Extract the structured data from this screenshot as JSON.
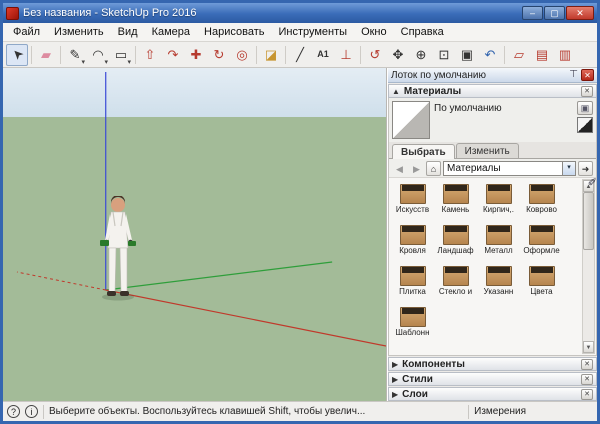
{
  "window": {
    "title": "Без названия - SketchUp Pro 2016"
  },
  "menu": {
    "items": [
      "Файл",
      "Изменить",
      "Вид",
      "Камера",
      "Нарисовать",
      "Инструменты",
      "Окно",
      "Справка"
    ]
  },
  "toolbar": {
    "tools": [
      {
        "name": "select",
        "glyph": "➤"
      },
      {
        "name": "eraser",
        "glyph": "▰"
      },
      {
        "name": "line",
        "glyph": "✎"
      },
      {
        "name": "arc",
        "glyph": "◠"
      },
      {
        "name": "rectangle",
        "glyph": "▭"
      },
      {
        "name": "push-pull",
        "glyph": "⇧"
      },
      {
        "name": "follow-me",
        "glyph": "↷"
      },
      {
        "name": "move",
        "glyph": "✚"
      },
      {
        "name": "rotate",
        "glyph": "↻"
      },
      {
        "name": "offset",
        "glyph": "◎"
      },
      {
        "name": "paint-bucket",
        "glyph": "◪"
      },
      {
        "name": "tape-measure",
        "glyph": "╱"
      },
      {
        "name": "text",
        "glyph": "A1"
      },
      {
        "name": "axes",
        "glyph": "⊥"
      },
      {
        "name": "orbit",
        "glyph": "↺"
      },
      {
        "name": "pan",
        "glyph": "✥"
      },
      {
        "name": "zoom",
        "glyph": "⊕"
      },
      {
        "name": "zoom-window",
        "glyph": "⊡"
      },
      {
        "name": "zoom-extents",
        "glyph": "▣"
      },
      {
        "name": "previous-view",
        "glyph": "↶"
      },
      {
        "name": "section-plane",
        "glyph": "▱"
      },
      {
        "name": "section-display",
        "glyph": "▤"
      },
      {
        "name": "section-cut",
        "glyph": "▥"
      }
    ]
  },
  "tray": {
    "title": "Лоток по умолчанию",
    "materials": {
      "title": "Материалы",
      "current": "По умолчанию",
      "tabs": [
        {
          "label": "Выбрать"
        },
        {
          "label": "Изменить"
        }
      ],
      "collection": "Материалы",
      "tiles": [
        {
          "label": "Искусств"
        },
        {
          "label": "Камень"
        },
        {
          "label": "Кирпич,."
        },
        {
          "label": "Коврово"
        },
        {
          "label": "Кровля"
        },
        {
          "label": "Ландшаф"
        },
        {
          "label": "Металл"
        },
        {
          "label": "Оформле"
        },
        {
          "label": "Плитка"
        },
        {
          "label": "Стекло и"
        },
        {
          "label": "Указанн"
        },
        {
          "label": "Цвета"
        },
        {
          "label": "Шаблонн"
        }
      ]
    },
    "sections": [
      {
        "label": "Компоненты"
      },
      {
        "label": "Стили"
      },
      {
        "label": "Слои"
      }
    ]
  },
  "statusbar": {
    "message": "Выберите объекты. Воспользуйтесь клавишей Shift, чтобы увелич...",
    "measure_label": "Измерения"
  },
  "icons": {
    "dropdown": "▾",
    "close": "✕",
    "pin": "⊤",
    "collapse": "▲",
    "expand": "▶",
    "back": "◀",
    "forward": "▶",
    "home": "⌂",
    "details_arrow": "➜",
    "eyedropper": "✐",
    "secondary_pane": "▣",
    "minimize": "–",
    "maximize": "▢",
    "scroll_up": "▲",
    "scroll_down": "▼",
    "help": "?",
    "info": "i"
  },
  "colors": {
    "sky": "#cfdfeb",
    "ground": "#a3bb98",
    "axis_red": "#c0392b",
    "axis_green": "#2e9e3a",
    "axis_blue": "#3a49d6",
    "titlebar": "#3a6cb8"
  }
}
